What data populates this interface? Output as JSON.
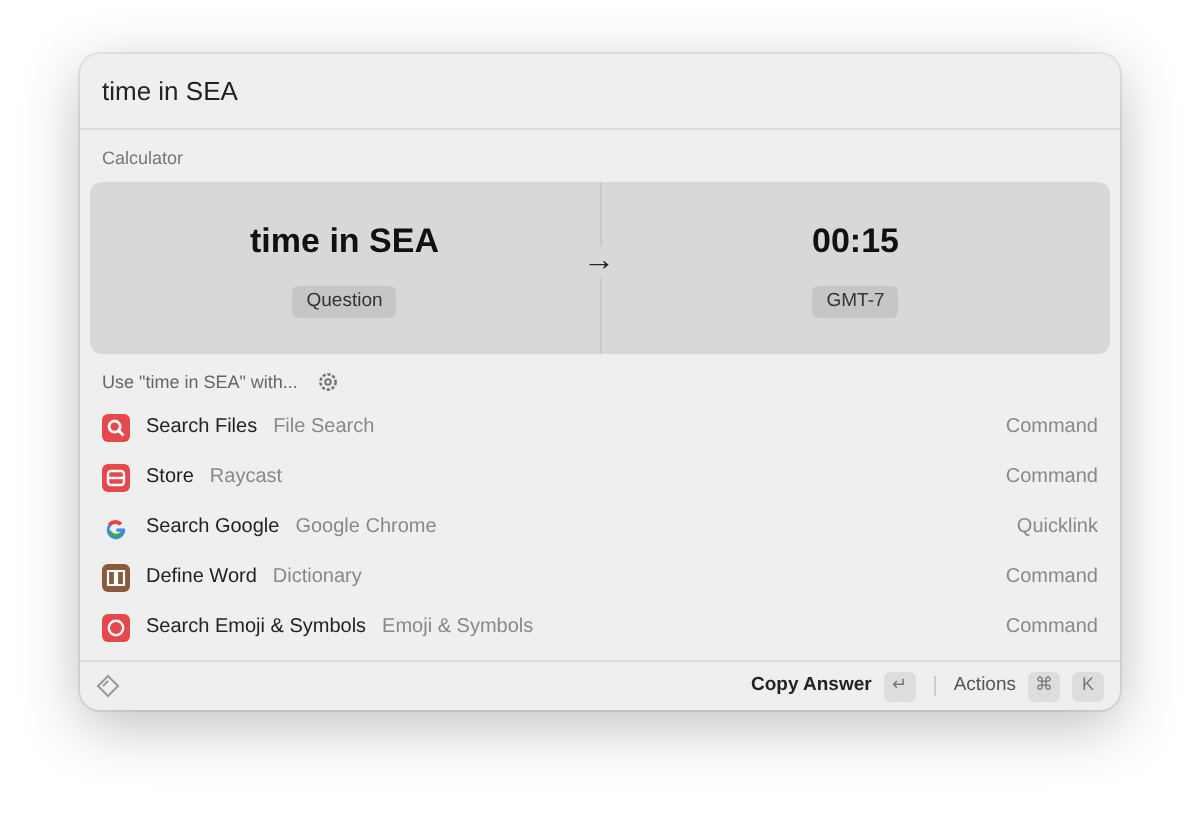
{
  "search": {
    "value": "time in SEA"
  },
  "calculator": {
    "section_title": "Calculator",
    "question": "time in SEA",
    "question_label": "Question",
    "arrow": "→",
    "answer": "00:15",
    "answer_label": "GMT-7"
  },
  "fallback": {
    "title": "Use \"time in SEA\" with...",
    "items": [
      {
        "title": "Search Files",
        "subtitle": "File Search",
        "type": "Command"
      },
      {
        "title": "Store",
        "subtitle": "Raycast",
        "type": "Command"
      },
      {
        "title": "Search Google",
        "subtitle": "Google Chrome",
        "type": "Quicklink"
      },
      {
        "title": "Define Word",
        "subtitle": "Dictionary",
        "type": "Command"
      },
      {
        "title": "Search Emoji & Symbols",
        "subtitle": "Emoji & Symbols",
        "type": "Command"
      }
    ]
  },
  "footer": {
    "primary_action": "Copy Answer",
    "primary_key": "↵",
    "actions_label": "Actions",
    "action_keys": [
      "⌘",
      "K"
    ]
  }
}
